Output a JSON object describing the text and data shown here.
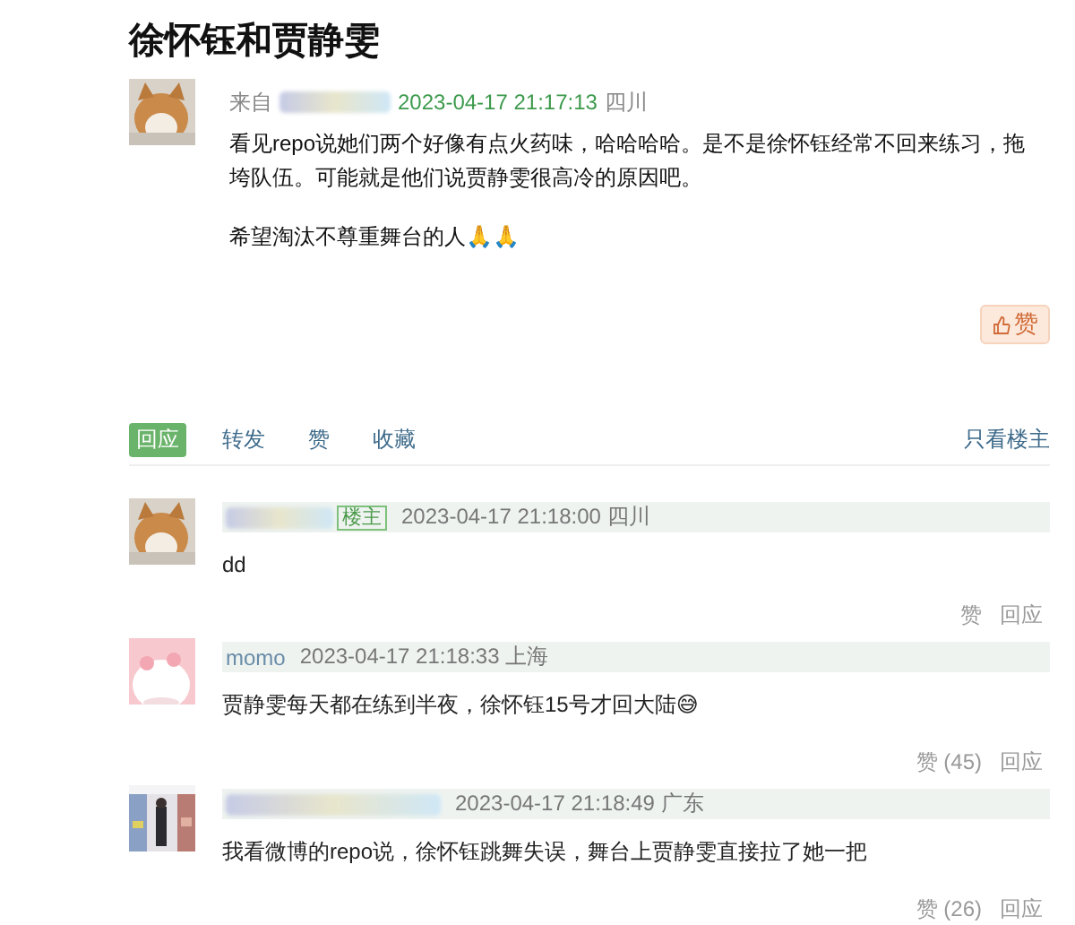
{
  "title": "徐怀钰和贾静雯",
  "post": {
    "source_label": "来自",
    "time": "2023-04-17 21:17:13",
    "location": "四川",
    "paragraphs": [
      "看见repo说她们两个好像有点火药味，哈哈哈哈。是不是徐怀钰经常不回来练习，拖垮队伍。可能就是他们说贾静雯很高冷的原因吧。",
      "希望淘汰不尊重舞台的人🙏🙏"
    ],
    "like_button": "赞",
    "actions": [
      {
        "label": "回应",
        "selected": true
      },
      {
        "label": "转发",
        "selected": false
      },
      {
        "label": "赞",
        "selected": false
      },
      {
        "label": "收藏",
        "selected": false
      }
    ],
    "author_only": "只看楼主"
  },
  "replies": [
    {
      "badge": "楼主",
      "time": "2023-04-17 21:18:00",
      "location": "四川",
      "text": "dd",
      "like": "赞",
      "reply": "回应"
    },
    {
      "name": "momo",
      "time": "2023-04-17 21:18:33",
      "location": "上海",
      "text": "贾静雯每天都在练到半夜，徐怀钰15号才回大陆😅",
      "like": "赞 (45)",
      "reply": "回应"
    },
    {
      "time": "2023-04-17 21:18:49",
      "location": "广东",
      "text": "我看微博的repo说，徐怀钰跳舞失误，舞台上贾静雯直接拉了她一把",
      "like": "赞 (26)",
      "reply": "回应"
    }
  ]
}
